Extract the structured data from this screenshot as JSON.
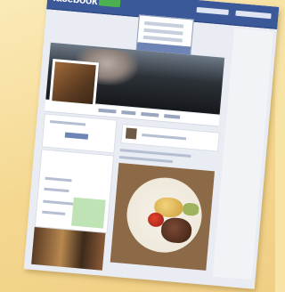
{
  "window": {
    "brand": "facebook"
  },
  "cover": {
    "title_text": ""
  },
  "colors": {
    "topbar": "#3b5998",
    "badge": "#4caf50",
    "highlight": "#6d84b4",
    "background": "#f7e3a6"
  },
  "icons": {
    "logo": "facebook-logo",
    "profile": "profile-photo",
    "avatar": "avatar-icon"
  }
}
